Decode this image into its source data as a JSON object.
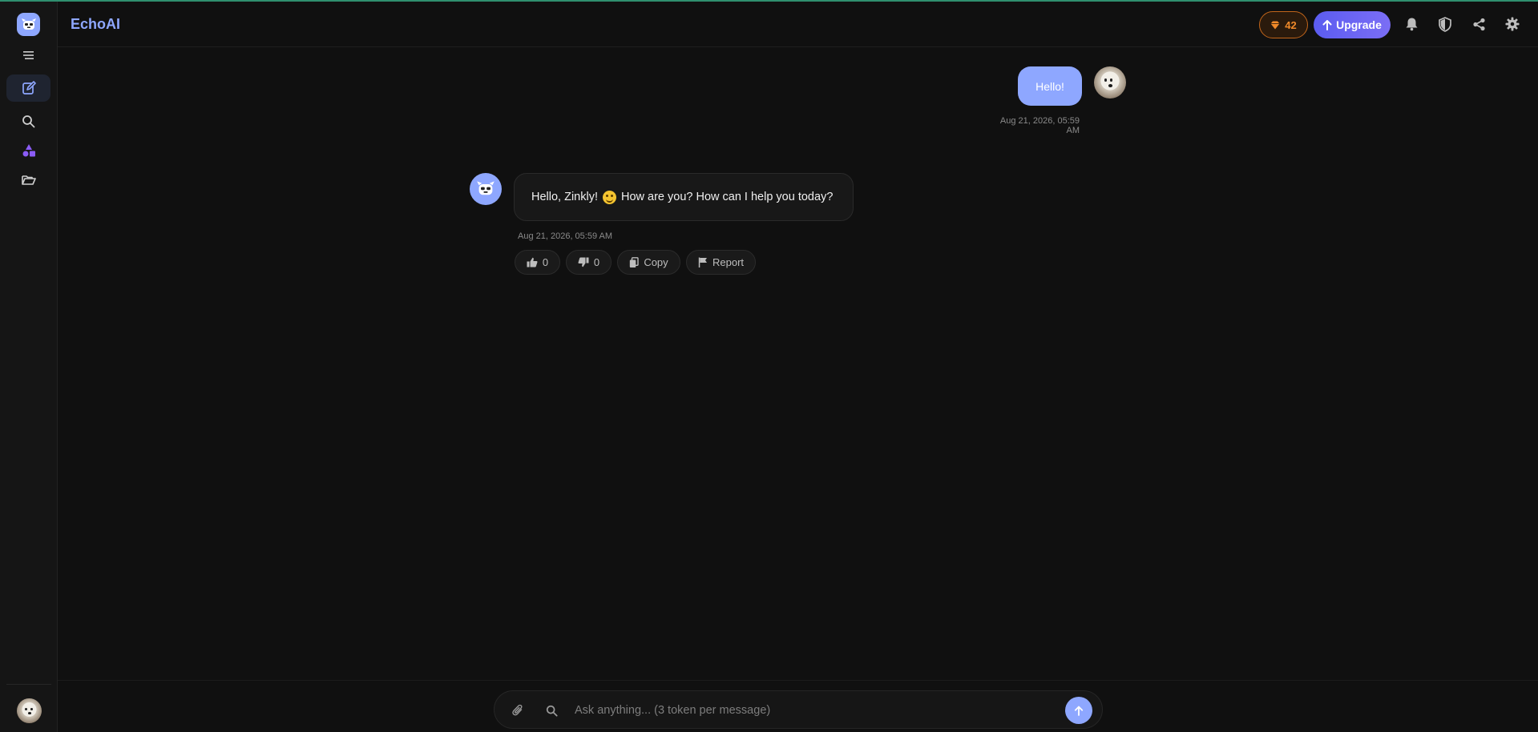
{
  "app": {
    "brand": "EchoAI"
  },
  "header": {
    "gems_count": "42",
    "upgrade_label": "Upgrade",
    "icons": [
      "bell-icon",
      "shield-icon",
      "share-icon",
      "gear-icon"
    ]
  },
  "sidebar": {
    "items": [
      {
        "name": "menu",
        "icon": "hamburger-icon"
      },
      {
        "name": "new-chat",
        "icon": "edit-icon",
        "active": true
      },
      {
        "name": "search",
        "icon": "search-icon"
      },
      {
        "name": "explore",
        "icon": "shapes-icon"
      },
      {
        "name": "folders",
        "icon": "folder-open-icon"
      }
    ]
  },
  "messages": [
    {
      "role": "user",
      "text": "Hello!",
      "time": "Aug 21, 2026, 05:59 AM"
    },
    {
      "role": "assistant",
      "text_before": "Hello, Zinkly!",
      "emoji": "smiling-face",
      "text_after": "How are you? How can I help you today?",
      "time": "Aug 21, 2026, 05:59 AM",
      "actions": {
        "like_count": "0",
        "dislike_count": "0",
        "copy_label": "Copy",
        "report_label": "Report"
      }
    }
  ],
  "composer": {
    "placeholder": "Ask anything... (3 token per message)",
    "value": ""
  },
  "colors": {
    "accent": "#8ea7ff",
    "upgrade": "#5b5cf0",
    "gems": "#f08a2a",
    "background": "#101010"
  }
}
